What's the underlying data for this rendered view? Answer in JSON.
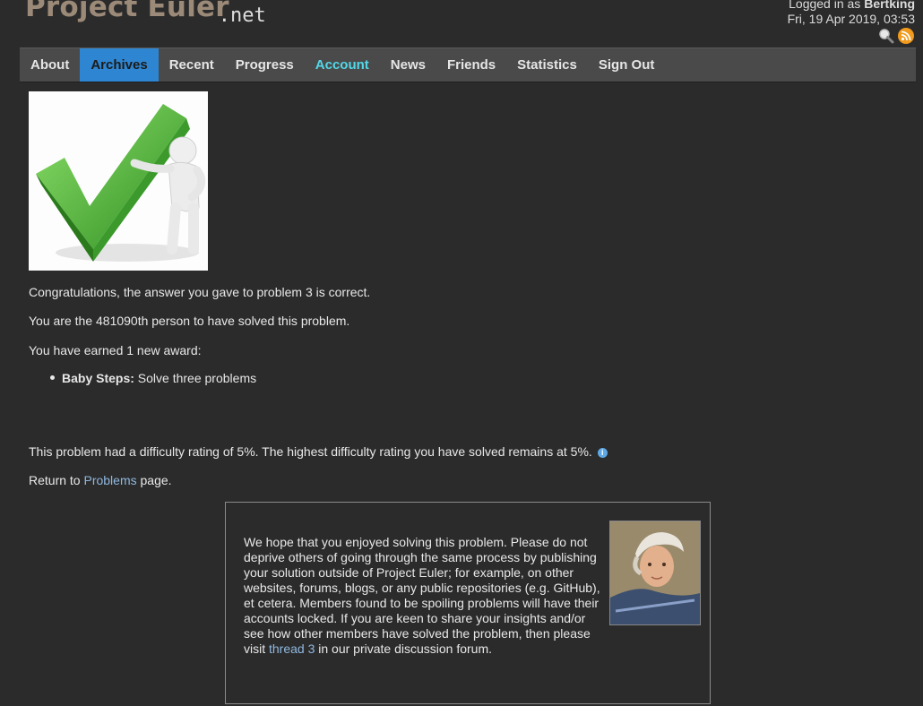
{
  "header": {
    "logo_main": "Project Euler",
    "logo_suffix": ".net",
    "logged_in_prefix": "Logged in as ",
    "username": "Bertking",
    "datetime": "Fri, 19 Apr 2019, 03:53"
  },
  "nav": {
    "tabs": [
      {
        "label": "About"
      },
      {
        "label": "Archives"
      },
      {
        "label": "Recent"
      },
      {
        "label": "Progress"
      },
      {
        "label": "Account"
      },
      {
        "label": "News"
      },
      {
        "label": "Friends"
      },
      {
        "label": "Statistics"
      },
      {
        "label": "Sign Out"
      }
    ],
    "active": "Archives",
    "highlight": "Account",
    "active_color": "#2e86d2",
    "highlight_color": "#52d8e8"
  },
  "result": {
    "congrats": "Congratulations, the answer you gave to problem 3 is correct.",
    "rank": "You are the 481090th person to have solved this problem.",
    "award_intro": "You have earned 1 new award:",
    "award_name": "Baby Steps:",
    "award_desc": " Solve three problems",
    "difficulty": "This problem had a difficulty rating of 5%. The highest difficulty rating you have solved remains at 5%.",
    "return_prefix": "Return to ",
    "return_link": "Problems",
    "return_suffix": " page."
  },
  "notice": {
    "text_main": "We hope that you enjoyed solving this problem. Please do not deprive others of going through the same process by publishing your solution outside of Project Euler; for example, on other websites, forums, blogs, or any public repositories (e.g. GitHub), et cetera. Members found to be spoiling problems will have their accounts locked. If you are keen to share your insights and/or see how other members have solved the problem, then please visit ",
    "thread_link": "thread 3",
    "text_end": " in our private discussion forum."
  }
}
